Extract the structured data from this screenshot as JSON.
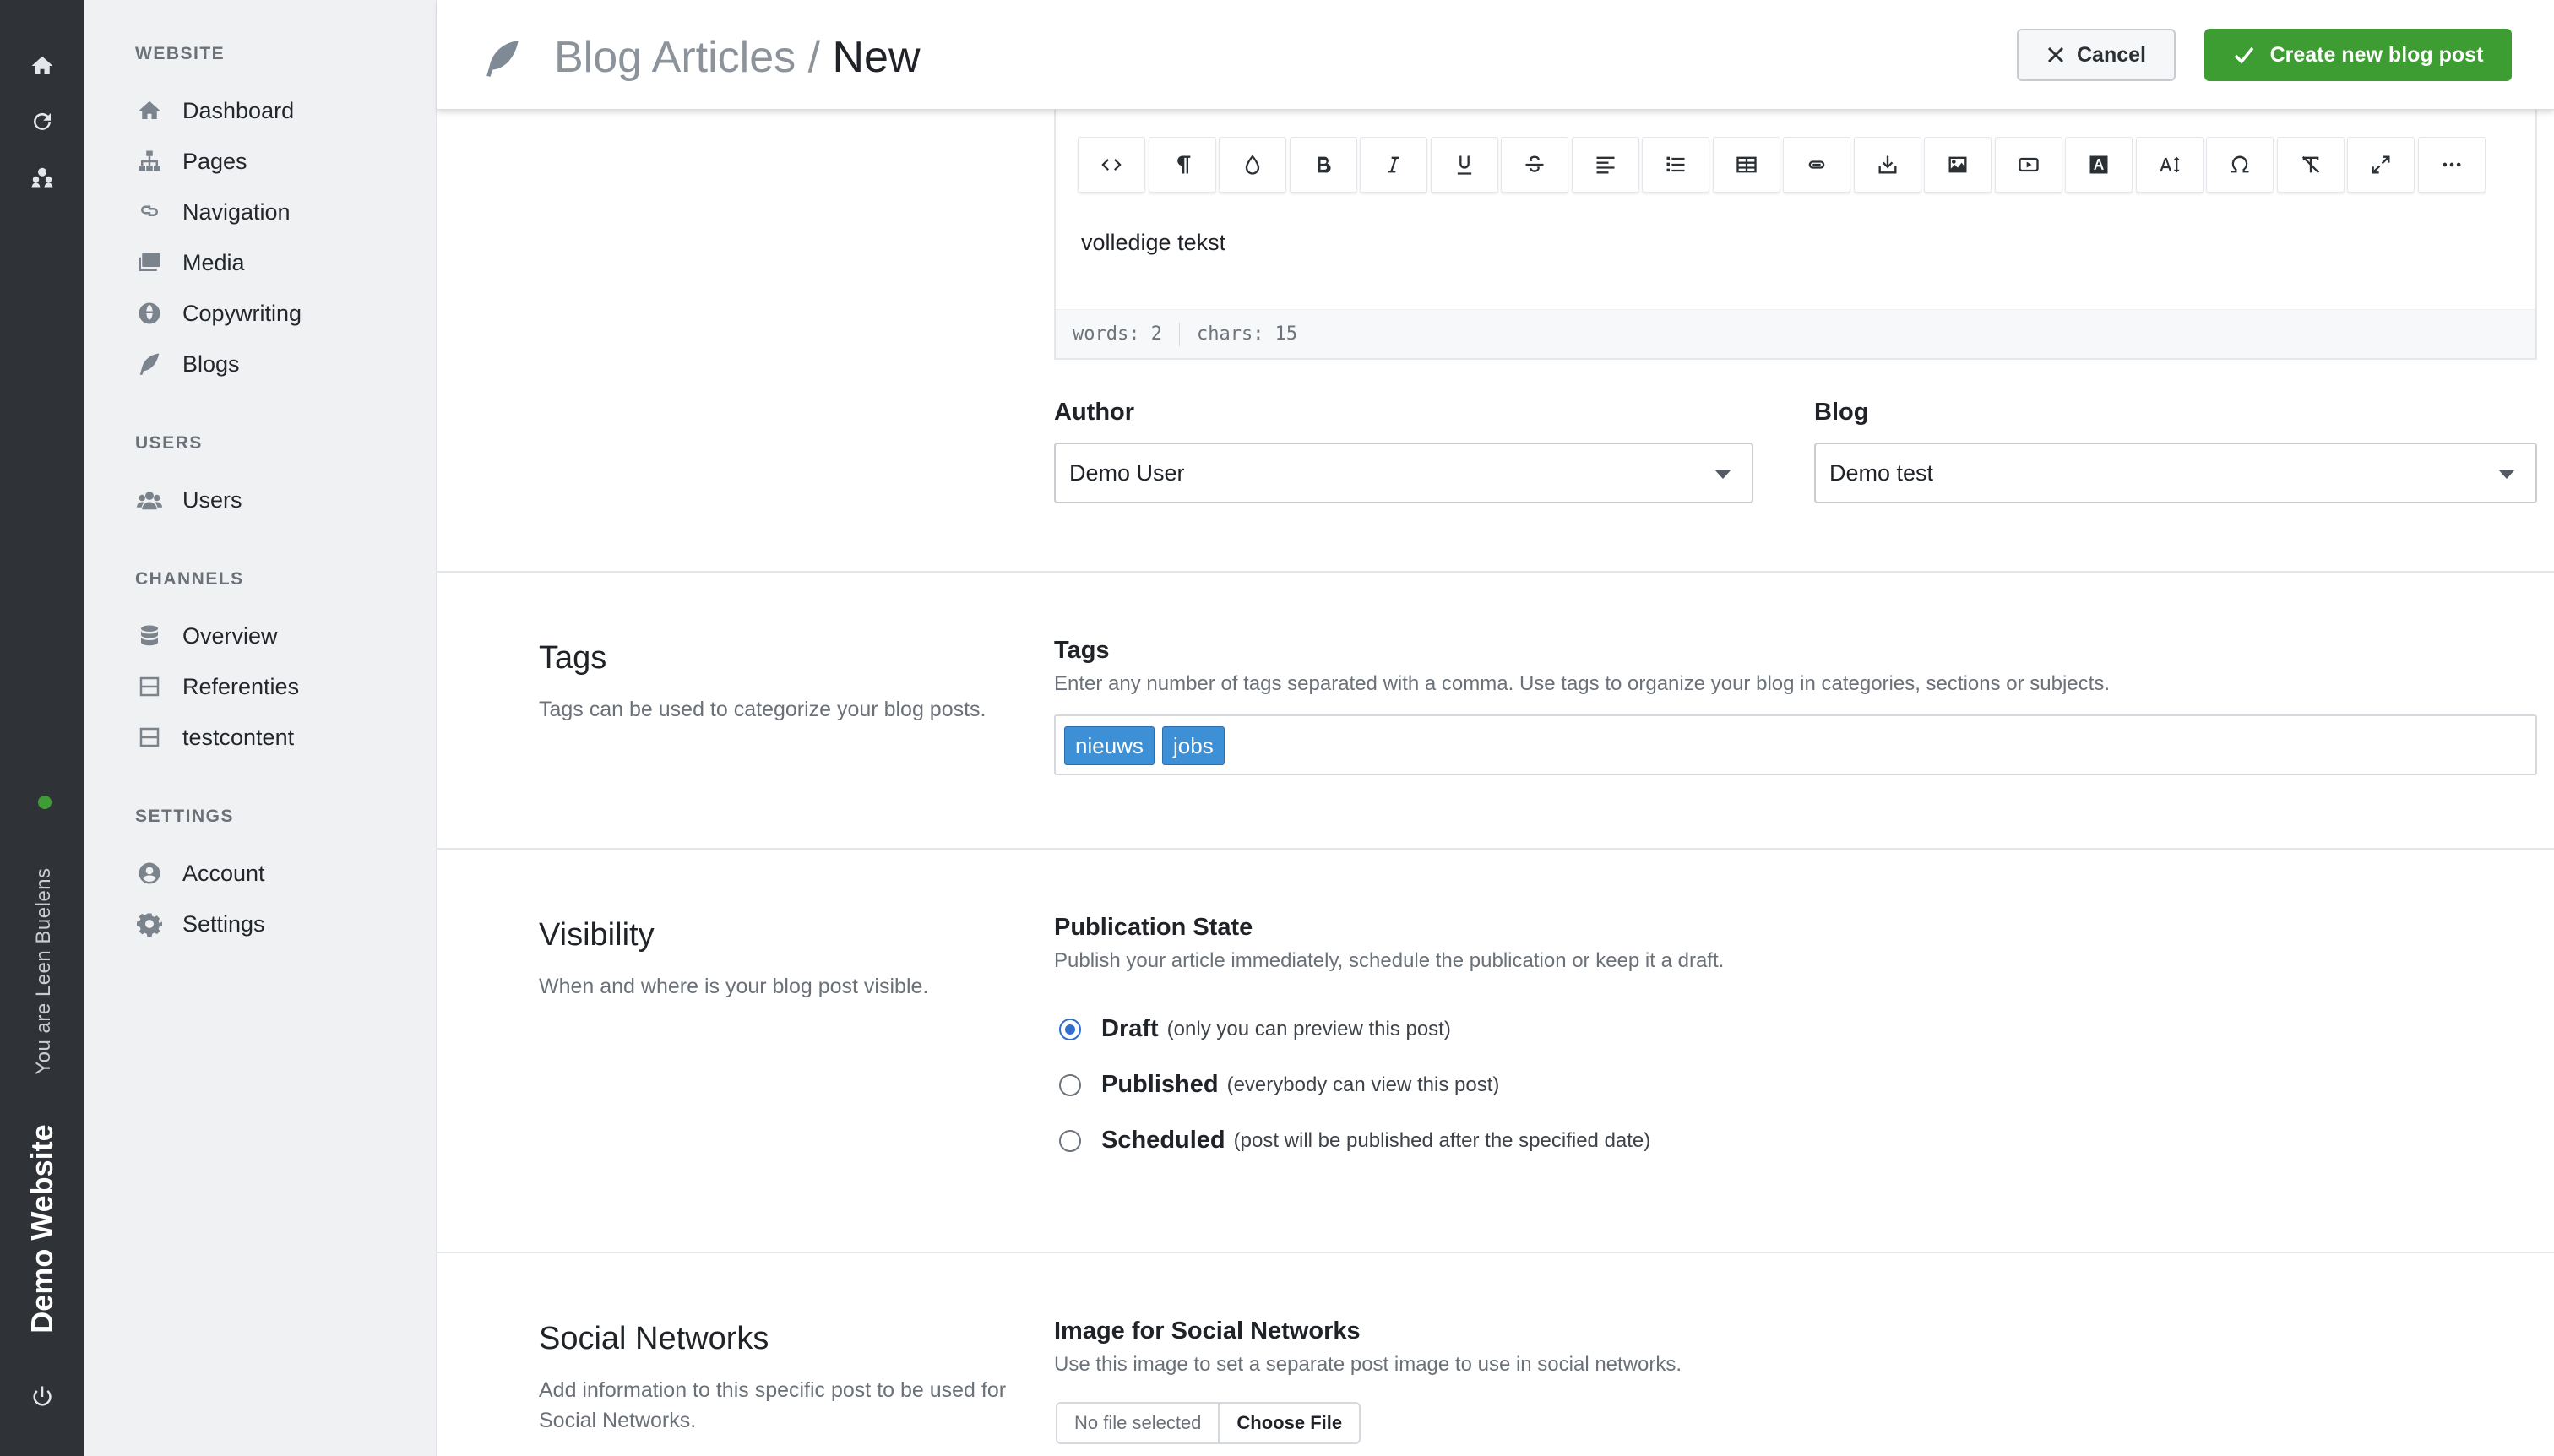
{
  "rail": {
    "user_text": "You are Leen Buelens",
    "site_name": "Demo Website"
  },
  "sidebar": {
    "groups": [
      {
        "title": "WEBSITE",
        "items": [
          {
            "label": "Dashboard",
            "icon": "home-icon"
          },
          {
            "label": "Pages",
            "icon": "sitemap-icon"
          },
          {
            "label": "Navigation",
            "icon": "link-icon"
          },
          {
            "label": "Media",
            "icon": "images-icon"
          },
          {
            "label": "Copywriting",
            "icon": "globe-icon"
          },
          {
            "label": "Blogs",
            "icon": "feather-icon"
          }
        ]
      },
      {
        "title": "USERS",
        "items": [
          {
            "label": "Users",
            "icon": "users-icon"
          }
        ]
      },
      {
        "title": "CHANNELS",
        "items": [
          {
            "label": "Overview",
            "icon": "database-icon"
          },
          {
            "label": "Referenties",
            "icon": "box-icon"
          },
          {
            "label": "testcontent",
            "icon": "box-icon"
          }
        ]
      },
      {
        "title": "SETTINGS",
        "items": [
          {
            "label": "Account",
            "icon": "user-circle-icon"
          },
          {
            "label": "Settings",
            "icon": "gear-icon"
          }
        ]
      }
    ]
  },
  "header": {
    "breadcrumb_parent": "Blog Articles",
    "breadcrumb_sep": " / ",
    "breadcrumb_current": "New",
    "cancel_label": "Cancel",
    "create_label": "Create new blog post"
  },
  "editor": {
    "toolbar": [
      "code",
      "paragraph",
      "color",
      "bold",
      "italic",
      "underline",
      "strikethrough",
      "align",
      "list",
      "table",
      "link",
      "embed",
      "image",
      "video",
      "font-color",
      "font-size",
      "special-char",
      "clear-format",
      "fullscreen",
      "more"
    ],
    "content": "volledige tekst",
    "status_words": "words: 2",
    "status_chars": "chars: 15"
  },
  "author": {
    "label": "Author",
    "value": "Demo User"
  },
  "blog": {
    "label": "Blog",
    "value": "Demo test"
  },
  "tags_section": {
    "title": "Tags",
    "description": "Tags can be used to categorize your blog posts.",
    "field_label": "Tags",
    "help": "Enter any number of tags separated with a comma. Use tags to organize your blog in categories, sections or subjects.",
    "tags": [
      "nieuws",
      "jobs"
    ]
  },
  "visibility": {
    "title": "Visibility",
    "description": "When and where is your blog post visible.",
    "field_label": "Publication State",
    "help": "Publish your article immediately, schedule the publication or keep it a draft.",
    "options": [
      {
        "label": "Draft",
        "hint": "(only you can preview this post)",
        "selected": true
      },
      {
        "label": "Published",
        "hint": "(everybody can view this post)",
        "selected": false
      },
      {
        "label": "Scheduled",
        "hint": "(post will be published after the specified date)",
        "selected": false
      }
    ]
  },
  "social": {
    "title": "Social Networks",
    "description": "Add information to this specific post to be used for Social Networks.",
    "field_label": "Image for Social Networks",
    "help": "Use this image to set a separate post image to use in social networks.",
    "file_status": "No file selected",
    "file_button": "Choose File"
  },
  "colors": {
    "accent_green": "#3d9d32",
    "tag_blue": "#3d8fd6",
    "rail_bg": "#2f3236",
    "sidebar_bg": "#f0f1f3"
  }
}
